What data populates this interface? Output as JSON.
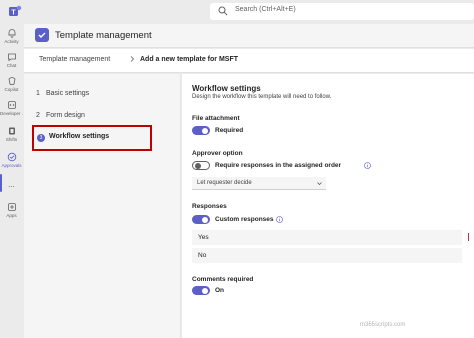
{
  "topbar": {
    "search_placeholder": "Search (Ctrl+Alt+E)",
    "logo_icon": "teams-logo-icon"
  },
  "rail": {
    "items": [
      {
        "label": "Activity",
        "icon": "bell-icon"
      },
      {
        "label": "Chat",
        "icon": "chat-icon"
      },
      {
        "label": "Copilot",
        "icon": "copilot-icon"
      },
      {
        "label": "Developer ...",
        "icon": "developer-icon"
      },
      {
        "label": "Shifts",
        "icon": "shifts-icon"
      },
      {
        "label": "Approvals",
        "icon": "approvals-icon"
      },
      {
        "label": "...",
        "icon": "more-icon"
      },
      {
        "label": "Apps",
        "icon": "apps-icon"
      }
    ]
  },
  "app": {
    "title": "Template management"
  },
  "breadcrumb": {
    "root": "Template management",
    "current": "Add a new template for MSFT"
  },
  "steps": [
    {
      "num": "1",
      "label": "Basic settings"
    },
    {
      "num": "2",
      "label": "Form design"
    },
    {
      "num": "3",
      "label": "Workflow settings"
    }
  ],
  "workflow": {
    "title": "Workflow settings",
    "description": "Design the workflow this template will need to follow.",
    "file_attachment": {
      "label": "File attachment",
      "toggle_text": "Required",
      "on": true
    },
    "approver_option": {
      "label": "Approver option",
      "toggle_text": "Require responses in the assigned order",
      "on": false,
      "dropdown_value": "Let requester decide"
    },
    "responses": {
      "label": "Responses",
      "toggle_text": "Custom responses",
      "on": true,
      "items": [
        "Yes",
        "No"
      ]
    },
    "comments": {
      "label": "Comments required",
      "toggle_text": "On",
      "on": true
    }
  },
  "watermark": "m365scripts.com",
  "colors": {
    "accent": "#5b5fc7",
    "highlight_border": "#c00000",
    "delete": "#c4314b"
  }
}
